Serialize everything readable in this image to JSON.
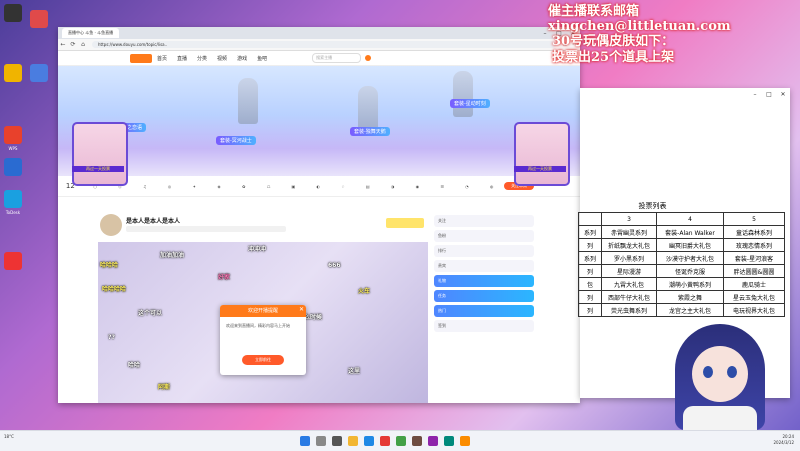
{
  "overlay": {
    "banner_text": "催主播联系邮箱xingchen@littletuan.com",
    "notice_line1": "30号玩偶皮肤如下：",
    "notice_line2": "投票出25个道具上架"
  },
  "desktop": {
    "icons": [
      {
        "label": "",
        "color": "#333"
      },
      {
        "label": "",
        "color": "#e04a4a"
      },
      {
        "label": "",
        "color": "#f0b400"
      },
      {
        "label": "",
        "color": "#4a7de0"
      },
      {
        "label": "WPS",
        "color": "#e8412c"
      },
      {
        "label": "",
        "color": "#2a6bd1"
      },
      {
        "label": "ToDesk",
        "color": "#1aa0e0"
      },
      {
        "label": "",
        "color": "#e33"
      }
    ]
  },
  "browser": {
    "tab_title": "直播中心 斗鱼 · 斗鱼直播",
    "url": "https://www.douyu.com/topic/lisa..",
    "site_nav": [
      "首页",
      "直播",
      "分类",
      "视频",
      "游戏",
      "鱼吧"
    ],
    "search_placeholder": "搜索主播",
    "skins": [
      "套装-冥河战士",
      "套装-独舞天鹅",
      "套装-星动时刻",
      "天之恋语"
    ],
    "left_badge": "再过一天投票",
    "right_badge": "再过一天投票",
    "categories": [
      "12",
      "",
      "",
      "",
      "",
      "",
      "",
      "",
      "",
      "",
      "",
      "",
      "",
      "",
      "",
      "",
      "",
      "",
      "",
      ""
    ],
    "category_button": "关注本周"
  },
  "player": {
    "streamer_name": "是本人是本人是本人",
    "danmaku": [
      "哈哈哈",
      "加油加油",
      "冲冲冲",
      "666",
      "火车",
      "哈哈哈哈",
      "好家",
      "这个可以",
      "什么时候",
      "??",
      "???",
      "哈哈",
      "这里",
      "阿斯"
    ],
    "popup_title": "欢迎开播提醒",
    "popup_body": "欢迎来到直播间，精彩内容马上开始",
    "popup_button": "立即前往"
  },
  "right_panel": {
    "items": [
      "关注",
      "鱼粉",
      "排行",
      "贵宾",
      "礼物",
      "任务",
      "热门",
      "签到"
    ]
  },
  "vote_table": {
    "title": "投票列表",
    "header": [
      "3",
      "4",
      "5"
    ],
    "rows": [
      [
        "系列",
        "赤霄幽灵系列",
        "套装-Alan Walker",
        "童话森林系列"
      ],
      [
        "列",
        "折纸飘龙大礼包",
        "幽冥旧爵大礼包",
        "玫瑰恋情系列"
      ],
      [
        "系列",
        "罗小黑系列",
        "沙漠守护者大礼包",
        "套装-星河浪客"
      ],
      [
        "列",
        "星际漫游",
        "怪诞乔克服",
        "胖达圆圆&圆圆"
      ],
      [
        "包",
        "九霄大礼包",
        "潮萌小黄鸭系列",
        "鹿瓜骑士"
      ],
      [
        "列",
        "西部牛仔大礼包",
        "紫霞之舞",
        "星云玉兔大礼包"
      ],
      [
        "列",
        "荧光虫舞系列",
        "龙宫之主大礼包",
        "电玩视界大礼包"
      ]
    ]
  },
  "taskbar": {
    "weather": "18°C",
    "time": "20:24",
    "date": "2024/3/12"
  }
}
